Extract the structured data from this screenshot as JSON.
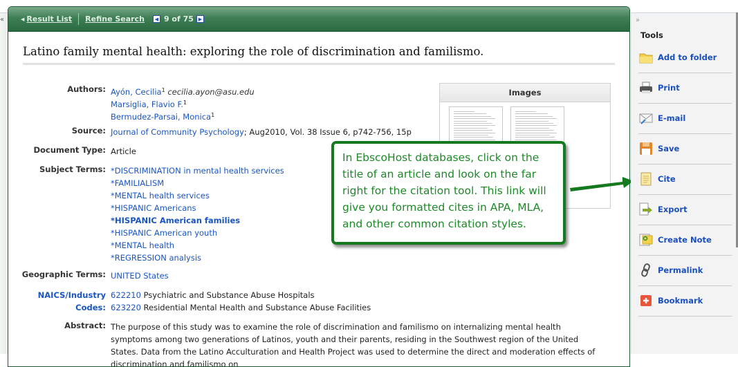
{
  "header": {
    "result_list": "Result List",
    "refine_search": "Refine Search",
    "pager": "9 of 75"
  },
  "record": {
    "title": "Latino family mental health: exploring the role of discrimination and familismo.",
    "labels": {
      "authors": "Authors:",
      "source": "Source:",
      "document_type": "Document Type:",
      "subject_terms": "Subject Terms:",
      "geographic_terms": "Geographic Terms:",
      "naics_1": "NAICS/Industry",
      "naics_2": "Codes:",
      "abstract": "Abstract:"
    },
    "authors": [
      {
        "name": "Ayón, Cecilia",
        "sup": "1",
        "email": "cecilia.ayon@asu.edu"
      },
      {
        "name": "Marsiglia, Flavio F.",
        "sup": "1"
      },
      {
        "name": "Bermudez-Parsai, Monica",
        "sup": "1"
      }
    ],
    "source_link": "Journal of Community Psychology",
    "source_detail": "; Aug2010, Vol. 38 Issue 6, p742-756, 15p",
    "document_type": "Article",
    "subject_terms": [
      "*DISCRIMINATION in mental health services",
      "*FAMILIALISM",
      "*MENTAL health services",
      "*HISPANIC Americans",
      "*HISPANIC American families",
      "*HISPANIC American youth",
      "*MENTAL health",
      "*REGRESSION analysis"
    ],
    "geographic_terms": "UNITED States",
    "naics": [
      {
        "code": "622210",
        "desc": " Psychiatric and Substance Abuse Hospitals"
      },
      {
        "code": "623220",
        "desc": " Residential Mental Health and Substance Abuse Facilities"
      }
    ],
    "abstract": "The purpose of this study was to examine the role of discrimination and familismo on internalizing mental health symptoms among two generations of Latinos, youth and their parents, residing in the Southwest region of the United States. Data from the Latino Acculturation and Health Project was used to determine the direct and moderation effects of discrimination and familismo on"
  },
  "images_panel": {
    "heading": "Images"
  },
  "callout": {
    "text": "In EbscoHost databases, click on the title of an article and look on the far right for the citation tool. This link will give you formatted cites in APA, MLA, and other common citation styles."
  },
  "tools": {
    "heading": "Tools",
    "items": [
      {
        "label": "Add to folder",
        "icon": "folder-icon"
      },
      {
        "label": "Print",
        "icon": "printer-icon"
      },
      {
        "label": "E-mail",
        "icon": "email-icon"
      },
      {
        "label": "Save",
        "icon": "save-icon"
      },
      {
        "label": "Cite",
        "icon": "cite-icon"
      },
      {
        "label": "Export",
        "icon": "export-icon"
      },
      {
        "label": "Create Note",
        "icon": "note-icon"
      },
      {
        "label": "Permalink",
        "icon": "link-icon"
      },
      {
        "label": "Bookmark",
        "icon": "bookmark-icon"
      }
    ]
  },
  "colors": {
    "header_green": "#2a6a40",
    "link_blue": "#1a55c4",
    "callout_green": "#157a1f"
  }
}
